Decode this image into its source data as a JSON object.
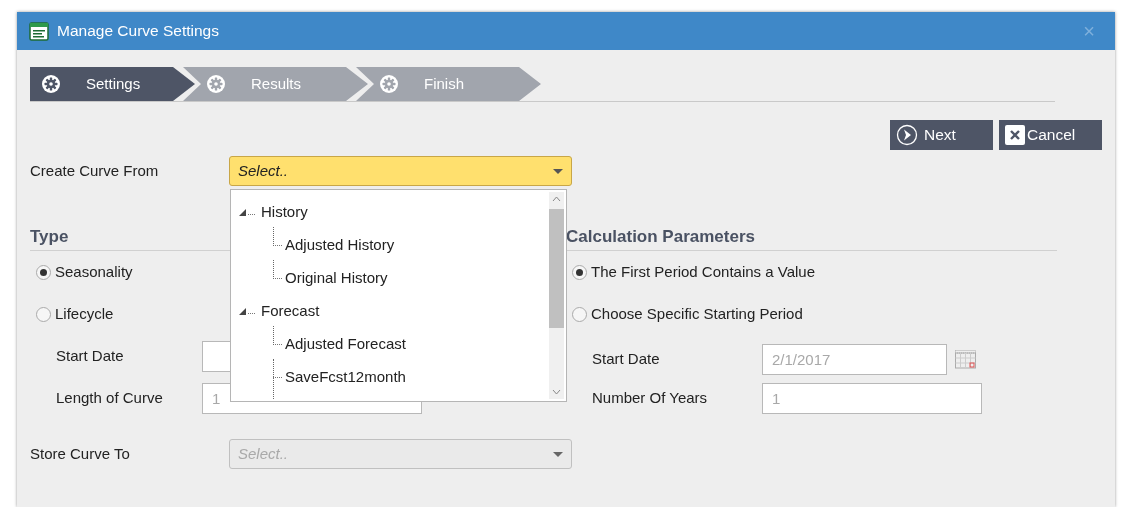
{
  "window": {
    "title": "Manage Curve Settings",
    "close": "×"
  },
  "steps": [
    {
      "label": "Settings",
      "selected": true
    },
    {
      "label": "Results",
      "selected": false
    },
    {
      "label": "Finish",
      "selected": false
    }
  ],
  "buttons": [
    {
      "label": "Next",
      "kind": "next"
    },
    {
      "label": "Cancel",
      "kind": "cancel"
    }
  ],
  "create_curve_from": {
    "label": "Create Curve From",
    "placeholder": "Select..",
    "expanded": true,
    "options": [
      {
        "label": "History",
        "expanded": true,
        "children": [
          {
            "label": "Adjusted History"
          },
          {
            "label": "Original History"
          }
        ]
      },
      {
        "label": "Forecast",
        "expanded": true,
        "children": [
          {
            "label": "Adjusted Forecast"
          },
          {
            "label": "SaveFcst12month"
          }
        ]
      }
    ]
  },
  "type": {
    "heading": "Type",
    "options": [
      {
        "label": "Seasonality",
        "selected": true
      },
      {
        "label": "Lifecycle",
        "selected": false
      }
    ],
    "fields": [
      {
        "label": "Start Date",
        "disabled": true
      },
      {
        "label": "Length of Curve",
        "value": "1",
        "disabled": true
      }
    ]
  },
  "calculation_parameters": {
    "heading": "Calculation Parameters",
    "options": [
      {
        "label": "The First Period Contains a Value",
        "selected": true
      },
      {
        "label": "Choose Specific Starting Period",
        "selected": false
      }
    ],
    "fields": [
      {
        "label": "Start Date",
        "value": "2/1/2017",
        "kind": "date",
        "disabled": true
      },
      {
        "label": "Number Of Years",
        "value": "1",
        "kind": "text",
        "disabled": true
      }
    ]
  },
  "store_curve_to": {
    "label": "Store Curve To",
    "placeholder": "Select..",
    "disabled": true
  }
}
